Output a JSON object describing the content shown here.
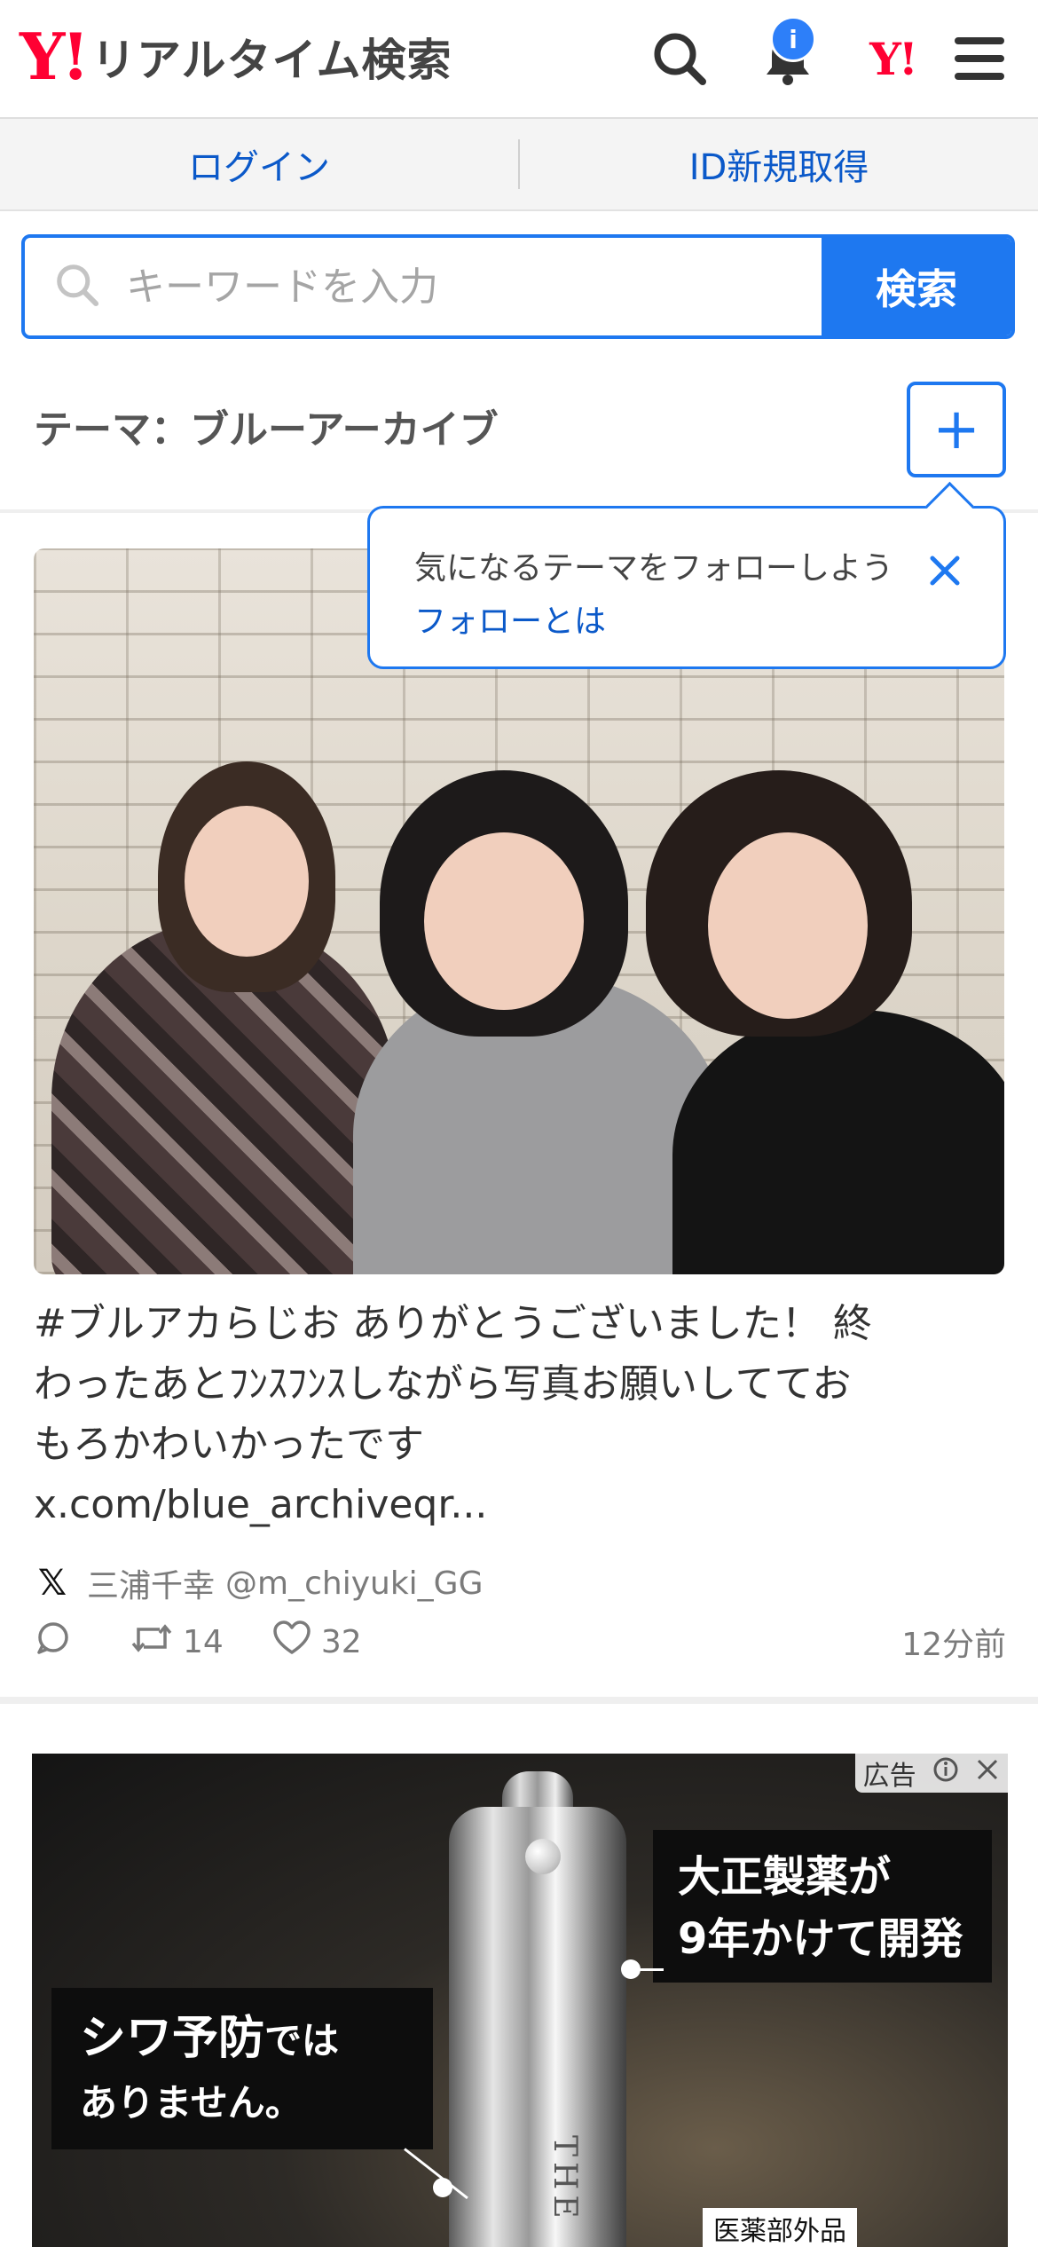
{
  "header": {
    "logo_y": "Y!",
    "logo_text": "リアルタイム検索",
    "notification_badge": "i",
    "yahoo_japan_mark": "Y!"
  },
  "account": {
    "login": "ログイン",
    "signup": "ID新規取得"
  },
  "search": {
    "placeholder": "キーワードを入力",
    "button": "検索"
  },
  "theme": {
    "title": "テーマ：ブルーアーカイブ",
    "follow_symbol": "+"
  },
  "tooltip": {
    "message": "気になるテーマをフォローしよう",
    "link": "フォローとは"
  },
  "post": {
    "text_line1": "#ブルアカらじお ありがとうございました！ 終",
    "text_line2": "わったあとﾌﾝｽﾌﾝｽしながら写真お願いしててお",
    "text_line3": "もろかわいかったです󠁿",
    "text_line4": "x.com/blue_archiveqr...",
    "author_name": "三浦千幸",
    "author_handle": "@m_chiyuki_GG",
    "retweets": "14",
    "likes": "32",
    "time": "12分前"
  },
  "ad": {
    "label": "広告",
    "headline1_line1": "大正製薬が",
    "headline1_line2": "9年かけて開発",
    "headline2_main": "シワ予防",
    "headline2_suffix": "では",
    "headline2_line2": "ありません。",
    "bottle_text": "THE",
    "category": "医薬部外品"
  }
}
